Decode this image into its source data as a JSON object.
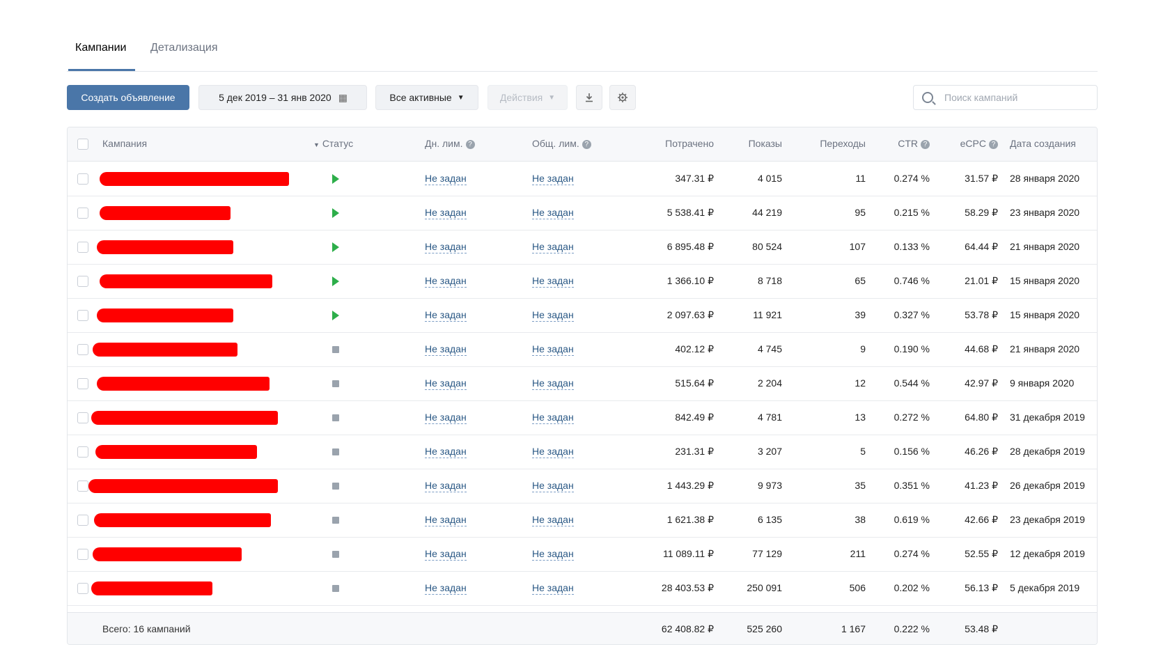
{
  "tabs": [
    {
      "label": "Кампании",
      "active": true
    },
    {
      "label": "Детализация",
      "active": false
    }
  ],
  "toolbar": {
    "create_label": "Создать объявление",
    "date_range": "5 дек 2019 – 31 янв 2020",
    "filter_label": "Все активные",
    "actions_label": "Действия",
    "search_placeholder": "Поиск кампаний"
  },
  "table": {
    "headers": {
      "campaign": "Кампания",
      "status": "Статус",
      "daily_limit": "Дн. лим.",
      "total_limit": "Общ. лим.",
      "spent": "Потрачено",
      "impressions": "Показы",
      "clicks": "Переходы",
      "ctr": "CTR",
      "ecpc": "eCPC",
      "created": "Дата создания"
    },
    "rows": [
      {
        "status": "active",
        "daily_limit": "Не задан",
        "total_limit": "Не задан",
        "spent": "347.31 ₽",
        "impressions": "4 015",
        "clicks": "11",
        "ctr": "0.274 %",
        "ecpc": "31.57 ₽",
        "created": "28 января 2020"
      },
      {
        "status": "active",
        "daily_limit": "Не задан",
        "total_limit": "Не задан",
        "spent": "5 538.41 ₽",
        "impressions": "44 219",
        "clicks": "95",
        "ctr": "0.215 %",
        "ecpc": "58.29 ₽",
        "created": "23 января 2020"
      },
      {
        "status": "active",
        "daily_limit": "Не задан",
        "total_limit": "Не задан",
        "spent": "6 895.48 ₽",
        "impressions": "80 524",
        "clicks": "107",
        "ctr": "0.133 %",
        "ecpc": "64.44 ₽",
        "created": "21 января 2020"
      },
      {
        "status": "active",
        "daily_limit": "Не задан",
        "total_limit": "Не задан",
        "spent": "1 366.10 ₽",
        "impressions": "8 718",
        "clicks": "65",
        "ctr": "0.746 %",
        "ecpc": "21.01 ₽",
        "created": "15 января 2020"
      },
      {
        "status": "active",
        "daily_limit": "Не задан",
        "total_limit": "Не задан",
        "spent": "2 097.63 ₽",
        "impressions": "11 921",
        "clicks": "39",
        "ctr": "0.327 %",
        "ecpc": "53.78 ₽",
        "created": "15 января 2020"
      },
      {
        "status": "stopped",
        "daily_limit": "Не задан",
        "total_limit": "Не задан",
        "spent": "402.12 ₽",
        "impressions": "4 745",
        "clicks": "9",
        "ctr": "0.190 %",
        "ecpc": "44.68 ₽",
        "created": "21 января 2020"
      },
      {
        "status": "stopped",
        "daily_limit": "Не задан",
        "total_limit": "Не задан",
        "spent": "515.64 ₽",
        "impressions": "2 204",
        "clicks": "12",
        "ctr": "0.544 %",
        "ecpc": "42.97 ₽",
        "created": "9 января 2020"
      },
      {
        "status": "stopped",
        "daily_limit": "Не задан",
        "total_limit": "Не задан",
        "spent": "842.49 ₽",
        "impressions": "4 781",
        "clicks": "13",
        "ctr": "0.272 %",
        "ecpc": "64.80 ₽",
        "created": "31 декабря 2019"
      },
      {
        "status": "stopped",
        "daily_limit": "Не задан",
        "total_limit": "Не задан",
        "spent": "231.31 ₽",
        "impressions": "3 207",
        "clicks": "5",
        "ctr": "0.156 %",
        "ecpc": "46.26 ₽",
        "created": "28 декабря 2019"
      },
      {
        "status": "stopped",
        "daily_limit": "Не задан",
        "total_limit": "Не задан",
        "spent": "1 443.29 ₽",
        "impressions": "9 973",
        "clicks": "35",
        "ctr": "0.351 %",
        "ecpc": "41.23 ₽",
        "created": "26 декабря 2019"
      },
      {
        "status": "stopped",
        "daily_limit": "Не задан",
        "total_limit": "Не задан",
        "spent": "1 621.38 ₽",
        "impressions": "6 135",
        "clicks": "38",
        "ctr": "0.619 %",
        "ecpc": "42.66 ₽",
        "created": "23 декабря 2019"
      },
      {
        "status": "stopped",
        "daily_limit": "Не задан",
        "total_limit": "Не задан",
        "spent": "11 089.11 ₽",
        "impressions": "77 129",
        "clicks": "211",
        "ctr": "0.274 %",
        "ecpc": "52.55 ₽",
        "created": "12 декабря 2019"
      },
      {
        "status": "stopped",
        "daily_limit": "Не задан",
        "total_limit": "Не задан",
        "spent": "28 403.53 ₽",
        "impressions": "250 091",
        "clicks": "506",
        "ctr": "0.202 %",
        "ecpc": "56.13 ₽",
        "created": "5 декабря 2019"
      }
    ],
    "footer": {
      "label": "Всего: 16 кампаний",
      "spent": "62 408.82 ₽",
      "impressions": "525 260",
      "clicks": "1 167",
      "ctr": "0.222 %",
      "ecpc": "53.48 ₽"
    }
  },
  "colors": {
    "accent": "#4a76a8",
    "status_active": "#2dae4a",
    "status_stopped": "#9aa3ad",
    "redaction": "#ff0000"
  },
  "icons": [
    "calendar-icon",
    "caret-down-icon",
    "download-icon",
    "gear-icon",
    "search-icon",
    "help-icon",
    "play-icon",
    "stop-icon"
  ]
}
